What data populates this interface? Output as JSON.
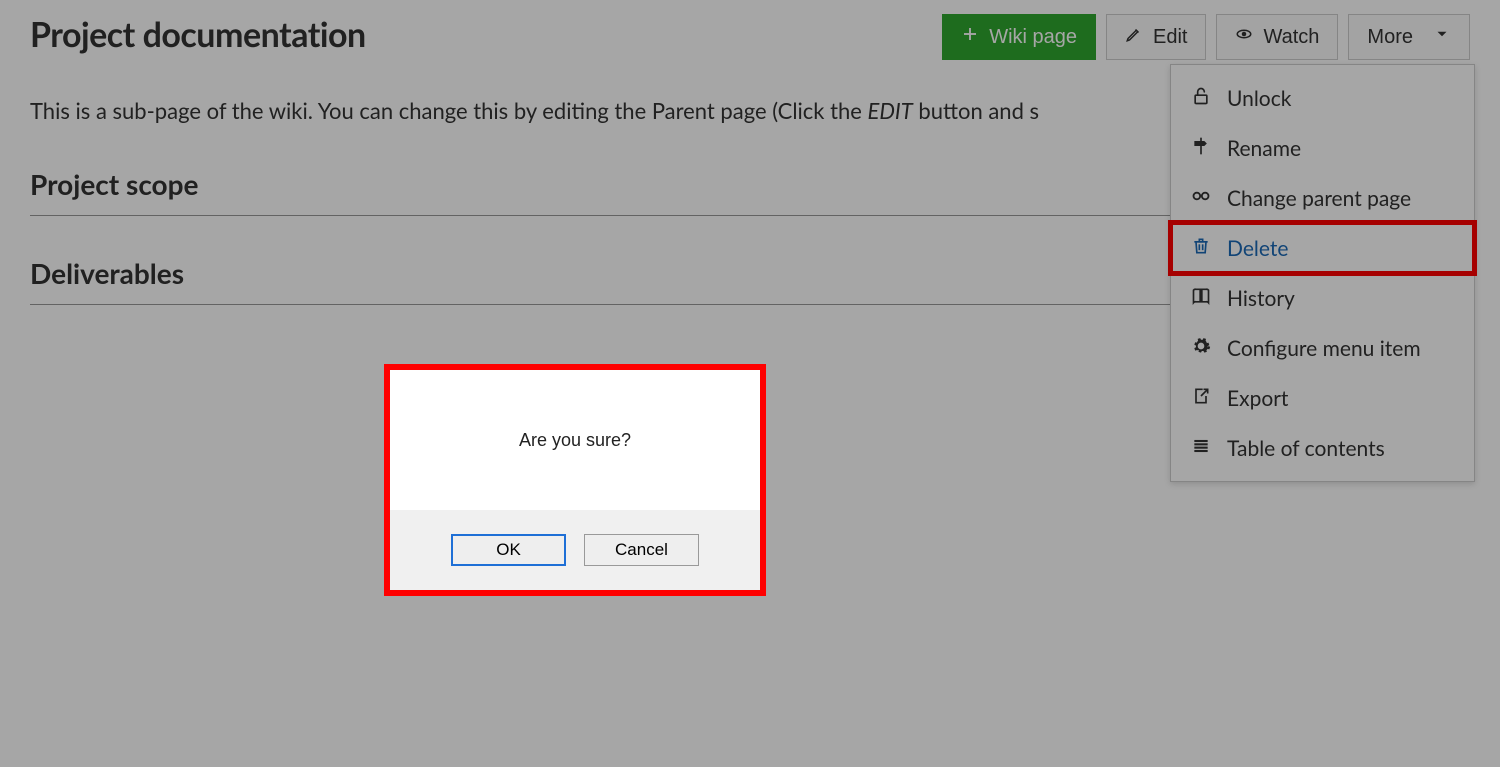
{
  "page": {
    "title": "Project documentation",
    "intro_prefix": "This is a sub-page of the wiki. You can change this by editing the Parent page (Click the ",
    "intro_italic": "EDIT",
    "intro_suffix": " button and s",
    "sections": [
      "Project scope",
      "Deliverables"
    ]
  },
  "toolbar": {
    "wiki_page": "Wiki page",
    "edit": "Edit",
    "watch": "Watch",
    "more": "More"
  },
  "more_menu": {
    "items": [
      {
        "icon": "unlock-icon",
        "label": "Unlock"
      },
      {
        "icon": "signpost-icon",
        "label": "Rename"
      },
      {
        "icon": "link-icon",
        "label": "Change parent page"
      },
      {
        "icon": "trash-icon",
        "label": "Delete",
        "active": true,
        "highlight": true
      },
      {
        "icon": "book-icon",
        "label": "History"
      },
      {
        "icon": "gear-icon",
        "label": "Configure menu item"
      },
      {
        "icon": "export-icon",
        "label": "Export"
      },
      {
        "icon": "toc-icon",
        "label": "Table of contents"
      }
    ]
  },
  "dialog": {
    "message": "Are you sure?",
    "ok": "OK",
    "cancel": "Cancel"
  }
}
